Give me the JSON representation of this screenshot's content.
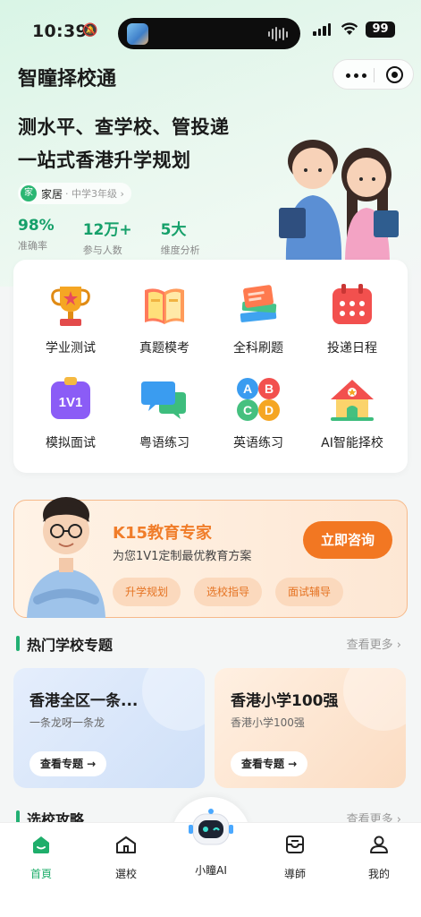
{
  "status_bar": {
    "time": "10:39",
    "battery": "99"
  },
  "header": {
    "app_title": "智瞳择校通"
  },
  "hero": {
    "slogan_line1": "测水平、查学校、管投递",
    "slogan_line2": "一站式香港升学规划",
    "user": {
      "avatar_text": "家",
      "name": "家居",
      "grade": "· 中学3年级 ›"
    },
    "stats": [
      {
        "value": "98%",
        "label": "准确率"
      },
      {
        "value": "12万+",
        "label": "参与人数"
      },
      {
        "value": "5大",
        "label": "维度分析"
      }
    ]
  },
  "features": [
    {
      "label": "学业测试",
      "icon": "trophy-icon"
    },
    {
      "label": "真题模考",
      "icon": "book-icon"
    },
    {
      "label": "全科刷题",
      "icon": "stacked-books-icon"
    },
    {
      "label": "投递日程",
      "icon": "calendar-icon"
    },
    {
      "label": "模拟面试",
      "icon": "1v1-clipboard-icon",
      "icon_text": "1V1"
    },
    {
      "label": "粤语练习",
      "icon": "chat-bubbles-icon"
    },
    {
      "label": "英语练习",
      "icon": "abcd-blocks-icon",
      "icon_letters": [
        "A",
        "B",
        "C",
        "D"
      ]
    },
    {
      "label": "AI智能择校",
      "icon": "school-house-icon"
    }
  ],
  "expert_banner": {
    "title": "K15教育专家",
    "desc": "为您1V1定制最优教育方案",
    "cta": "立即咨询",
    "tags": [
      "升学规划",
      "选校指导",
      "面试辅导"
    ]
  },
  "hot_schools": {
    "title": "热门学校专题",
    "more": "查看更多 ›",
    "cards": [
      {
        "title": "香港全区一条...",
        "subtitle": "一条龙呀一条龙",
        "button": "查看专题 →",
        "color": "#dce9fb"
      },
      {
        "title": "香港小学100强",
        "subtitle": "香港小学100强",
        "button": "查看专题 →",
        "color": "#fde6d2"
      }
    ]
  },
  "guide_section": {
    "title": "选校攻略",
    "more": "查看更多 ›"
  },
  "tabbar": [
    {
      "label": "首頁",
      "icon": "home-icon",
      "active": true
    },
    {
      "label": "選校",
      "icon": "school-icon",
      "active": false
    },
    {
      "label": "小瞳AI",
      "icon": "robot-icon",
      "active": false
    },
    {
      "label": "導師",
      "icon": "mentor-icon",
      "active": false
    },
    {
      "label": "我的",
      "icon": "profile-icon",
      "active": false
    }
  ],
  "colors": {
    "brand_green": "#1fae6b",
    "accent_orange": "#f27722"
  }
}
